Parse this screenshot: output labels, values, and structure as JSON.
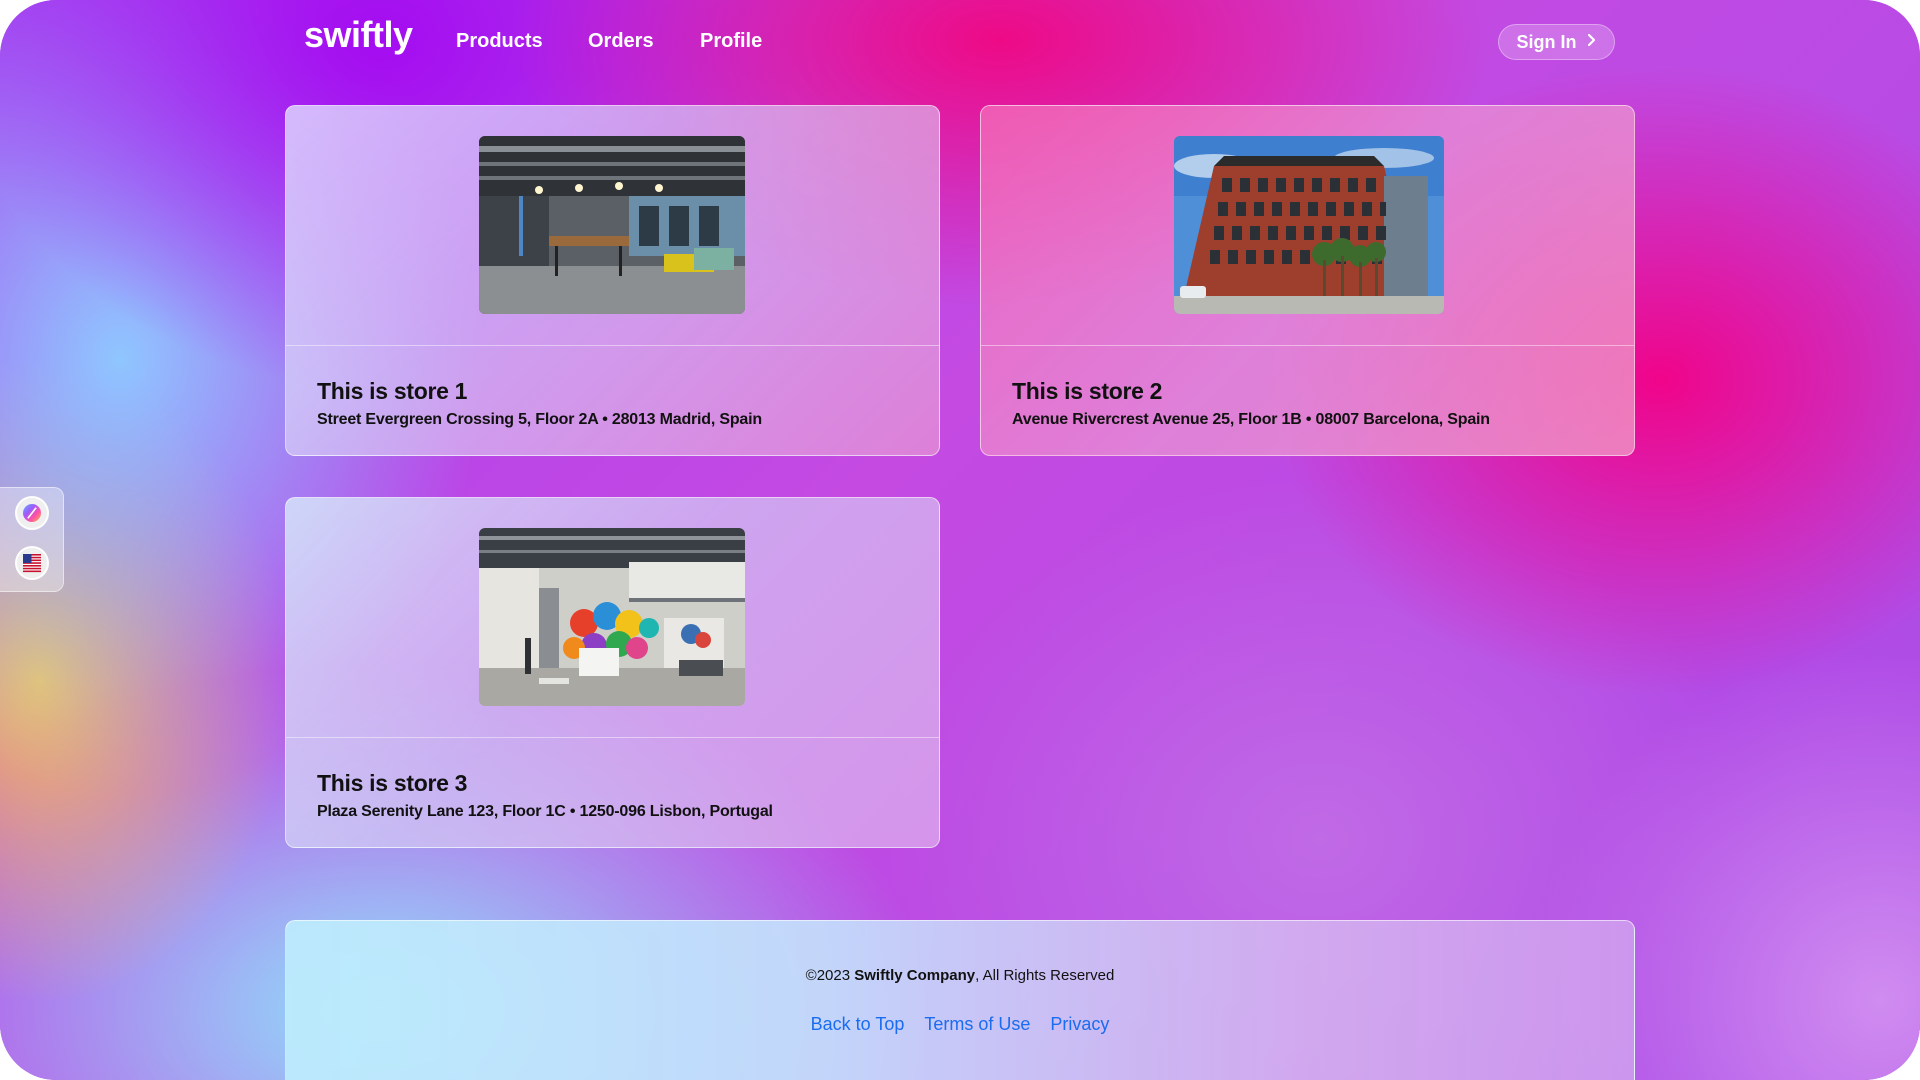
{
  "nav": {
    "logo": "swiftly",
    "links": [
      {
        "label": "Products"
      },
      {
        "label": "Orders"
      },
      {
        "label": "Profile"
      }
    ],
    "sign_in": {
      "label": "Sign In",
      "icon": "chevron-right-icon"
    }
  },
  "stores": [
    {
      "title": "This is store 1",
      "address": "Street Evergreen Crossing 5, Floor 2A • 28013 Madrid, Spain"
    },
    {
      "title": "This is store 2",
      "address": "Avenue Rivercrest Avenue 25, Floor 1B • 08007 Barcelona, Spain"
    },
    {
      "title": "This is store 3",
      "address": "Plaza Serenity Lane 123, Floor 1C • 1250-096 Lisbon, Portugal"
    }
  ],
  "side_widget": {
    "theme_icon": "theme-palette-icon",
    "language_icon": "us-flag-icon"
  },
  "footer": {
    "copyright_prefix": "©2023 ",
    "company": "Swiftly Company",
    "copyright_suffix": ", All Rights Reserved",
    "links": [
      {
        "label": "Back to Top"
      },
      {
        "label": "Terms of Use"
      },
      {
        "label": "Privacy"
      }
    ],
    "link_color": "#1a6cf0"
  }
}
